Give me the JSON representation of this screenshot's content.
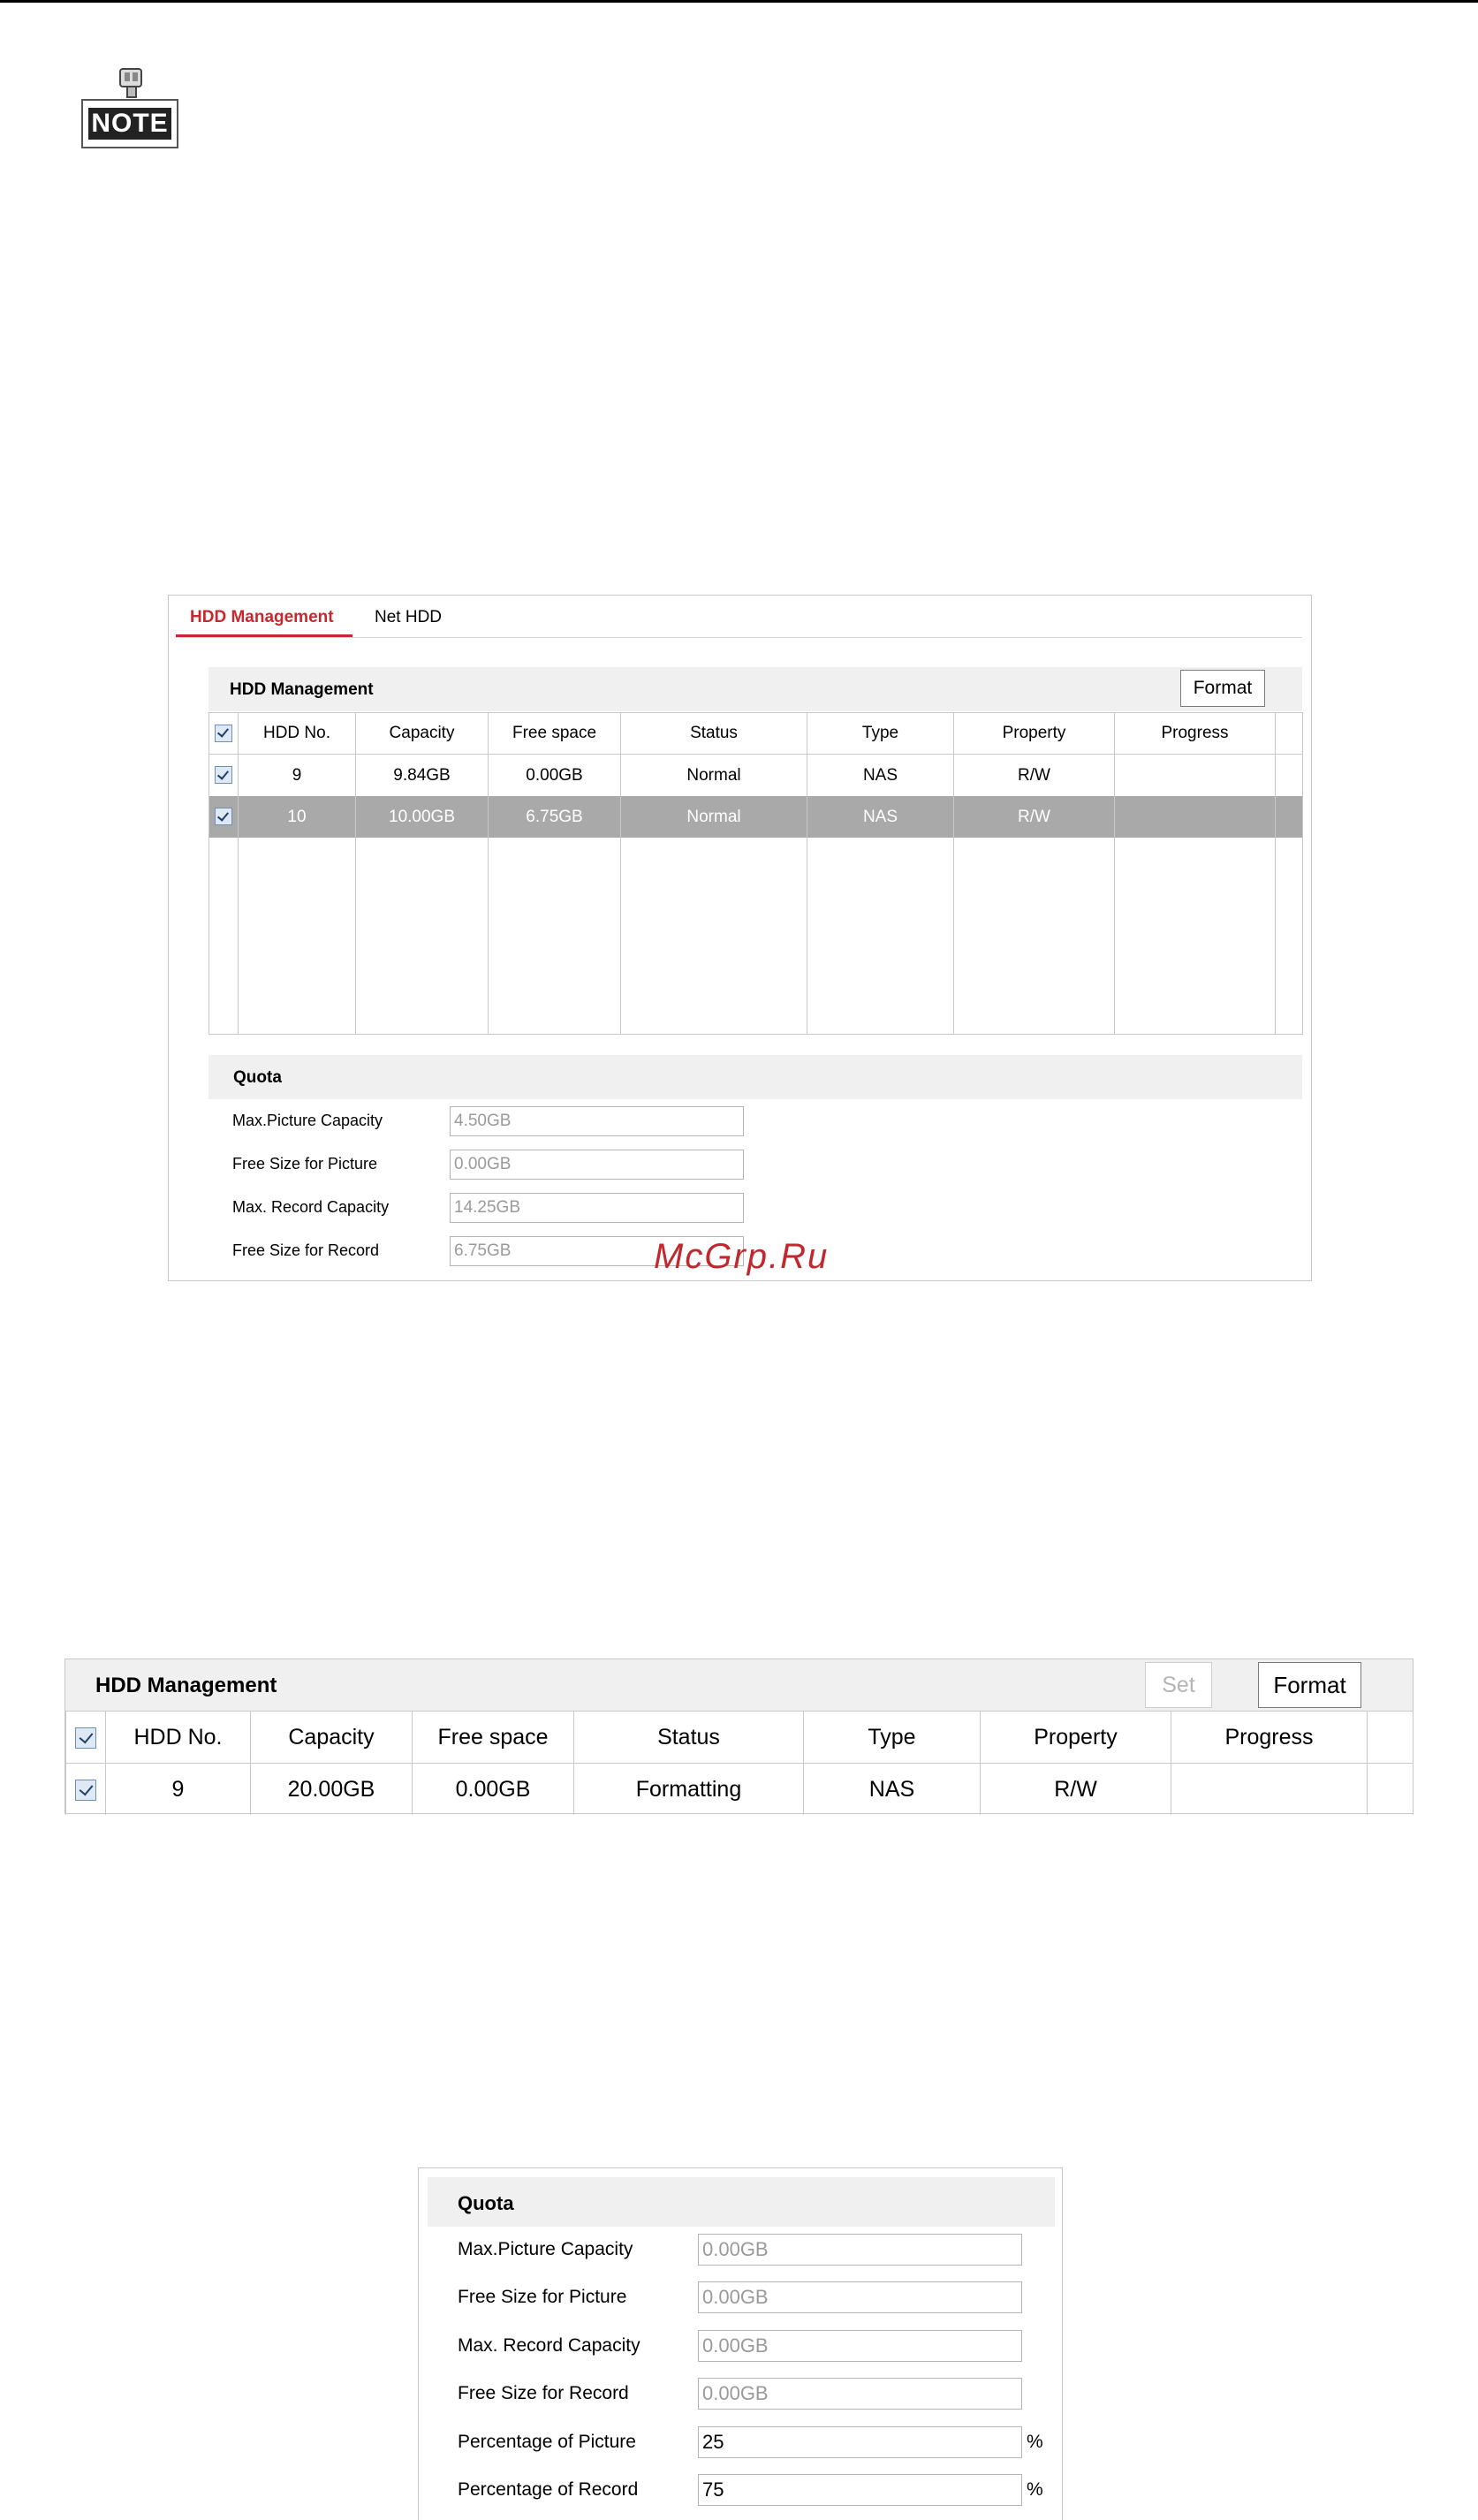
{
  "note": {
    "label": "NOTE"
  },
  "shot1": {
    "tabs": [
      {
        "label": "HDD Management",
        "active": true
      },
      {
        "label": "Net HDD",
        "active": false
      }
    ],
    "section_title": "HDD Management",
    "format_label": "Format",
    "columns": [
      "HDD No.",
      "Capacity",
      "Free space",
      "Status",
      "Type",
      "Property",
      "Progress"
    ],
    "rows": [
      {
        "checked": true,
        "selected": false,
        "hdd_no": "9",
        "capacity": "9.84GB",
        "free_space": "0.00GB",
        "status": "Normal",
        "type": "NAS",
        "property": "R/W",
        "progress": ""
      },
      {
        "checked": true,
        "selected": true,
        "hdd_no": "10",
        "capacity": "10.00GB",
        "free_space": "6.75GB",
        "status": "Normal",
        "type": "NAS",
        "property": "R/W",
        "progress": ""
      }
    ],
    "quota_title": "Quota",
    "quota": [
      {
        "label": "Max.Picture Capacity",
        "value": "4.50GB"
      },
      {
        "label": "Free Size for Picture",
        "value": "0.00GB"
      },
      {
        "label": "Max. Record Capacity",
        "value": "14.25GB"
      },
      {
        "label": "Free Size for Record",
        "value": "6.75GB"
      }
    ]
  },
  "watermark": "McGrp.Ru",
  "shot2": {
    "section_title": "HDD Management",
    "set_label": "Set",
    "format_label": "Format",
    "columns": [
      "HDD No.",
      "Capacity",
      "Free space",
      "Status",
      "Type",
      "Property",
      "Progress"
    ],
    "rows": [
      {
        "checked": true,
        "hdd_no": "9",
        "capacity": "20.00GB",
        "free_space": "0.00GB",
        "status": "Formatting",
        "type": "NAS",
        "property": "R/W",
        "progress": ""
      }
    ]
  },
  "shot3": {
    "quota_title": "Quota",
    "fields": [
      {
        "label": "Max.Picture Capacity",
        "value": "0.00GB"
      },
      {
        "label": "Free Size for Picture",
        "value": "0.00GB"
      },
      {
        "label": "Max. Record Capacity",
        "value": "0.00GB"
      },
      {
        "label": "Free Size for Record",
        "value": "0.00GB"
      },
      {
        "label": "Percentage of Picture",
        "value": "25",
        "unit": "%"
      },
      {
        "label": "Percentage of Record",
        "value": "75",
        "unit": "%"
      }
    ]
  }
}
